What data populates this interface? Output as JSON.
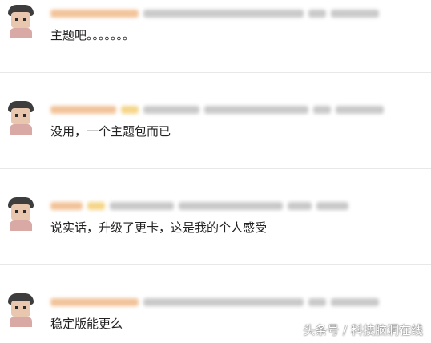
{
  "comments": [
    {
      "text": "主题吧。。。。。。。"
    },
    {
      "text": "没用，一个主题包而已"
    },
    {
      "text": "说实话，升级了更卡，这是我的个人感受"
    },
    {
      "text": "稳定版能更么"
    }
  ],
  "watermark": "头条号 / 科技脑洞在线",
  "colors": {
    "divider": "#e8e8e8",
    "username_blur": "#f2c39a",
    "badge_blur": "#f5d68a",
    "meta_blur": "#c9c9c9",
    "text": "#222222"
  }
}
